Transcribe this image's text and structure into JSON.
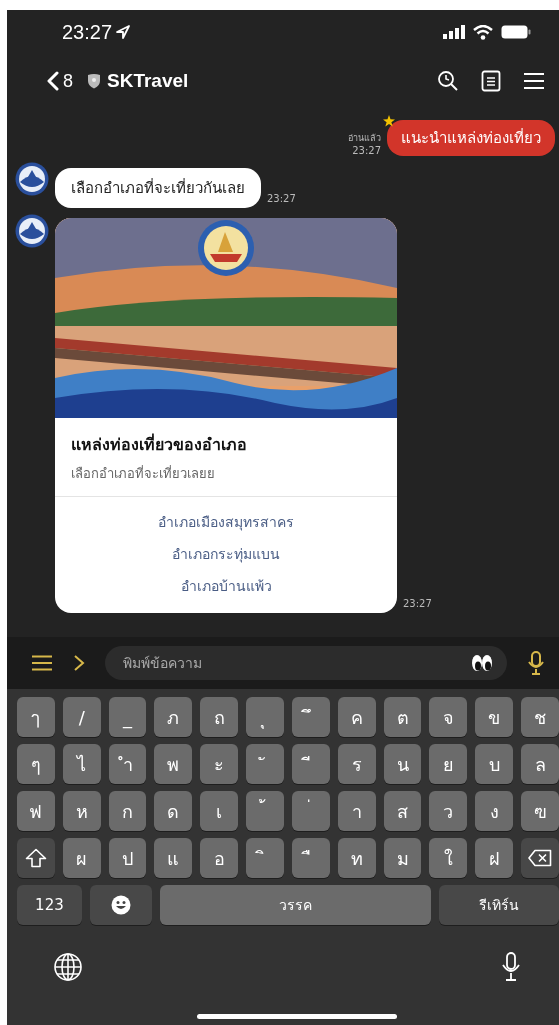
{
  "status_bar": {
    "time": "23:27"
  },
  "header": {
    "back_count": "8",
    "title": "SKTravel"
  },
  "messages": [
    {
      "kind": "outgoing",
      "text": "แนะนำแหล่งท่องเที่ยว",
      "read_label": "อ่านแล้ว",
      "time": "23:27"
    },
    {
      "kind": "incoming",
      "text": "เลือกอำเภอที่จะเที่ยวกันเลย",
      "time": "23:27"
    },
    {
      "kind": "card",
      "image": {
        "kind": "picture"
      },
      "title": "แหล่งท่องเที่ยวของอำเภอ",
      "subtitle": "เลือกอำเภอที่จะเที่ยวเลยย",
      "actions": [
        "อำเภอเมืองสมุทรสาคร",
        "อำเภอกระทุ่มแบน",
        "อำเภอบ้านแพ้ว"
      ],
      "time": "23:27"
    }
  ],
  "input": {
    "placeholder": "พิมพ์ข้อความ"
  },
  "keyboard": {
    "rows": [
      [
        {
          "kind": "char",
          "label": "ๅ"
        },
        {
          "kind": "char",
          "label": "/"
        },
        {
          "kind": "char",
          "label": "_"
        },
        {
          "kind": "char",
          "label": "ภ"
        },
        {
          "kind": "char",
          "label": "ถ"
        },
        {
          "kind": "char",
          "label": "ุ"
        },
        {
          "kind": "char",
          "label": "ึ"
        },
        {
          "kind": "char",
          "label": "ค"
        },
        {
          "kind": "char",
          "label": "ต"
        },
        {
          "kind": "char",
          "label": "จ"
        },
        {
          "kind": "char",
          "label": "ข"
        },
        {
          "kind": "char",
          "label": "ช"
        }
      ],
      [
        {
          "kind": "char",
          "label": "ๆ"
        },
        {
          "kind": "char",
          "label": "ไ"
        },
        {
          "kind": "char",
          "label": "ำ"
        },
        {
          "kind": "char",
          "label": "พ"
        },
        {
          "kind": "char",
          "label": "ะ"
        },
        {
          "kind": "char",
          "label": "ั"
        },
        {
          "kind": "char",
          "label": "ี"
        },
        {
          "kind": "char",
          "label": "ร"
        },
        {
          "kind": "char",
          "label": "น"
        },
        {
          "kind": "char",
          "label": "ย"
        },
        {
          "kind": "char",
          "label": "บ"
        },
        {
          "kind": "char",
          "label": "ล"
        }
      ],
      [
        {
          "kind": "char",
          "label": "ฟ"
        },
        {
          "kind": "char",
          "label": "ห"
        },
        {
          "kind": "char",
          "label": "ก"
        },
        {
          "kind": "char",
          "label": "ด"
        },
        {
          "kind": "char",
          "label": "เ"
        },
        {
          "kind": "char",
          "label": "้"
        },
        {
          "kind": "char",
          "label": "่"
        },
        {
          "kind": "char",
          "label": "า"
        },
        {
          "kind": "char",
          "label": "ส"
        },
        {
          "kind": "char",
          "label": "ว"
        },
        {
          "kind": "char",
          "label": "ง"
        },
        {
          "kind": "char",
          "label": "ฃ"
        }
      ],
      [
        {
          "kind": "shift"
        },
        {
          "kind": "char",
          "label": "ผ"
        },
        {
          "kind": "char",
          "label": "ป"
        },
        {
          "kind": "char",
          "label": "แ"
        },
        {
          "kind": "char",
          "label": "อ"
        },
        {
          "kind": "char",
          "label": "ิ"
        },
        {
          "kind": "char",
          "label": "ื"
        },
        {
          "kind": "char",
          "label": "ท"
        },
        {
          "kind": "char",
          "label": "ม"
        },
        {
          "kind": "char",
          "label": "ใ"
        },
        {
          "kind": "char",
          "label": "ฝ"
        },
        {
          "kind": "backspace"
        }
      ]
    ],
    "function_keys": [
      {
        "kind": "numbers",
        "label": "123"
      },
      {
        "kind": "emoji"
      },
      {
        "kind": "space",
        "label": "วรรค"
      },
      {
        "kind": "return",
        "label": "รีเทิร์น"
      }
    ]
  }
}
